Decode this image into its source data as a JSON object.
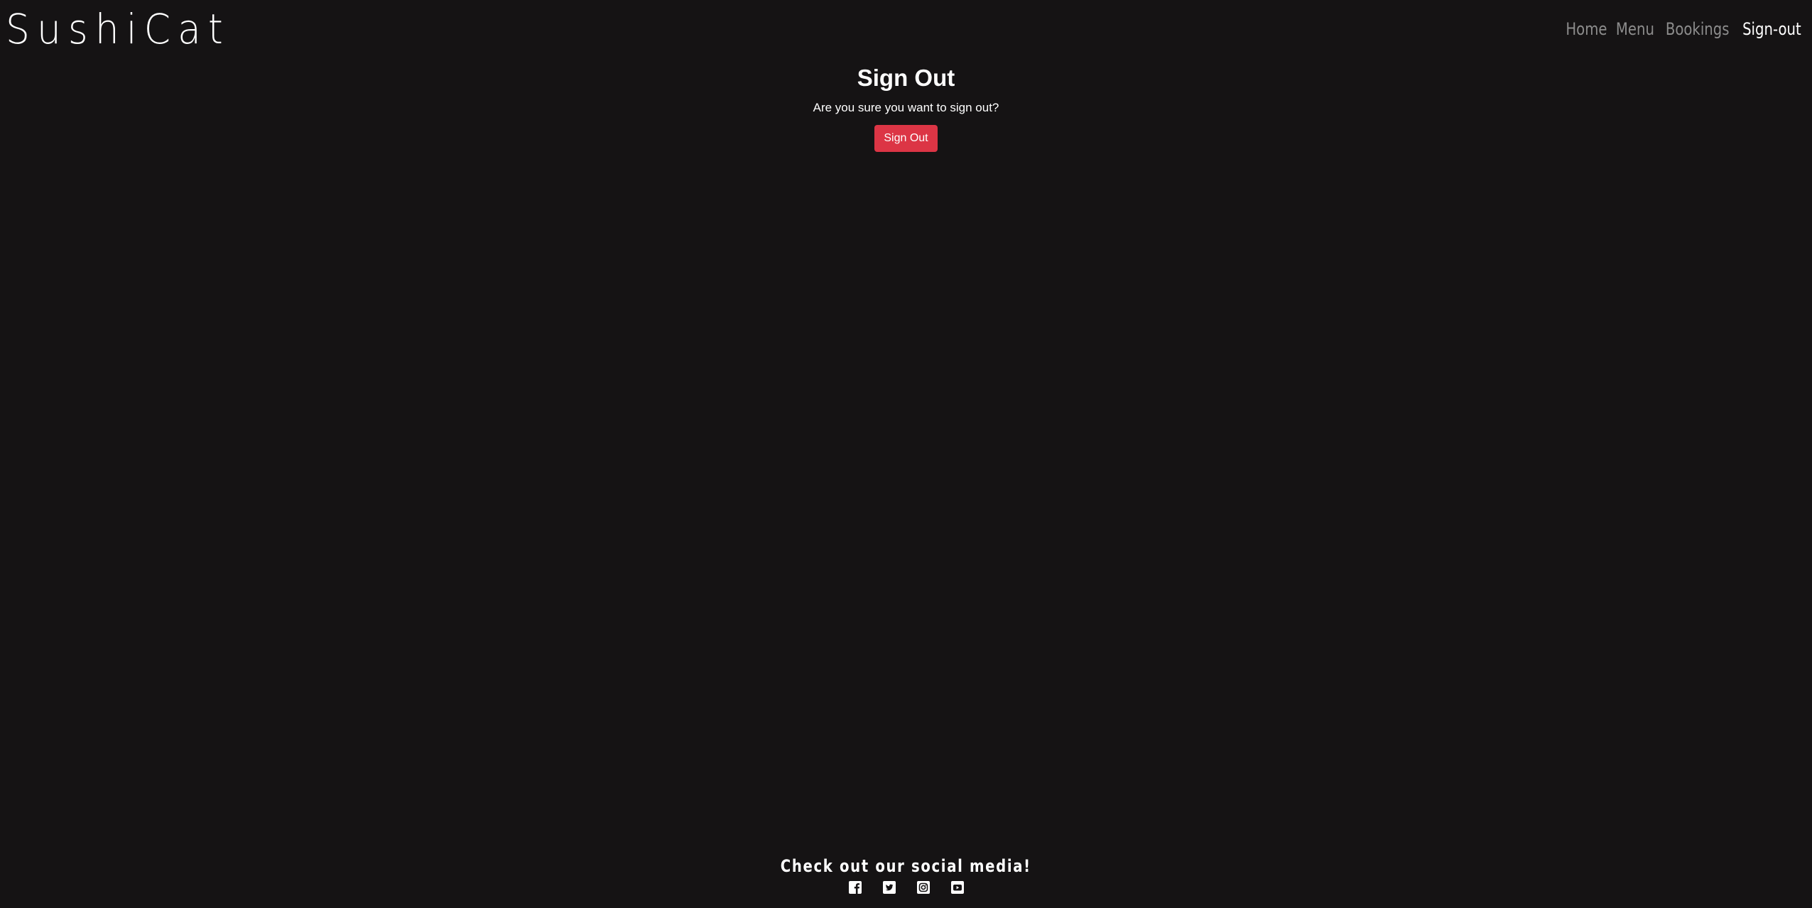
{
  "brand": {
    "name": "SushiCat"
  },
  "nav": {
    "items": [
      {
        "label": "Home",
        "active": false
      },
      {
        "label": "Menu",
        "active": false
      },
      {
        "label": "Bookings",
        "active": false
      },
      {
        "label": "Sign-out",
        "active": true
      }
    ]
  },
  "main": {
    "title": "Sign Out",
    "prompt": "Are you sure you want to sign out?",
    "button_label": "Sign Out"
  },
  "footer": {
    "title": "Check out our social media!",
    "socials": [
      {
        "icon": "facebook-icon"
      },
      {
        "icon": "twitter-icon"
      },
      {
        "icon": "instagram-icon"
      },
      {
        "icon": "youtube-icon"
      }
    ]
  },
  "colors": {
    "background": "#151314",
    "danger": "#dc3545",
    "nav_inactive": "#8c8c8c",
    "text": "#ffffff"
  }
}
